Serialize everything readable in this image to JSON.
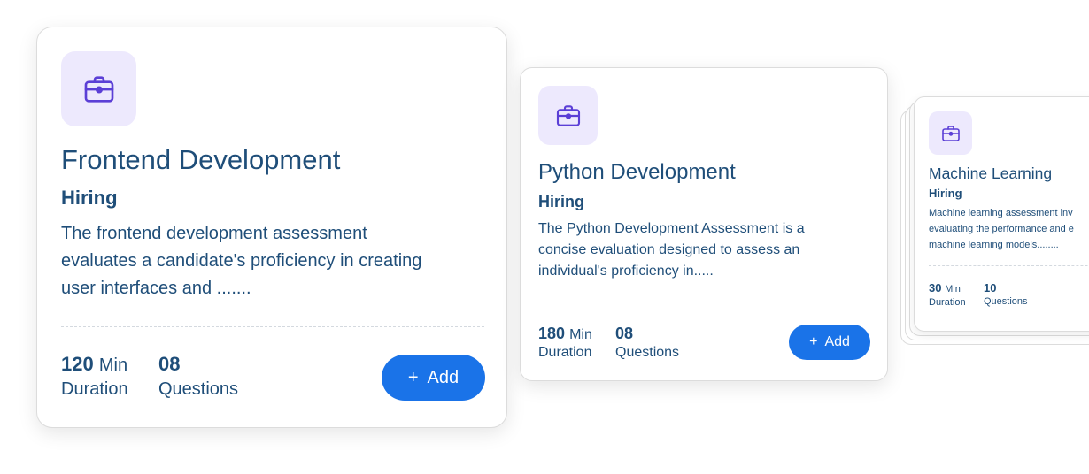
{
  "colors": {
    "accent": "#1a73e8",
    "text": "#1f4e79",
    "icon_bg": "#ede9fd",
    "icon_stroke": "#5b3fd6"
  },
  "cards": [
    {
      "icon": "briefcase-icon",
      "title": "Frontend Development",
      "subtitle": "Hiring",
      "description": "The frontend development assessment evaluates a candidate's proficiency in creating user interfaces and .......",
      "duration_value": "120",
      "duration_unit": "Min",
      "duration_label": "Duration",
      "questions_value": "08",
      "questions_label": "Questions",
      "add_label": "Add",
      "add_icon": "+"
    },
    {
      "icon": "briefcase-icon",
      "title": "Python Development",
      "subtitle": "Hiring",
      "description": "The Python Development Assessment is a concise evaluation designed to assess an individual's proficiency in.....",
      "duration_value": "180",
      "duration_unit": "Min",
      "duration_label": "Duration",
      "questions_value": "08",
      "questions_label": "Questions",
      "add_label": "Add",
      "add_icon": "+"
    },
    {
      "icon": "briefcase-icon",
      "title": "Machine Learning",
      "subtitle": "Hiring",
      "description": "Machine learning assessment inv\nevaluating the performance and e\nmachine learning models........",
      "duration_value": "30",
      "duration_unit": "Min",
      "duration_label": "Duration",
      "questions_value": "10",
      "questions_label": "Questions"
    }
  ]
}
